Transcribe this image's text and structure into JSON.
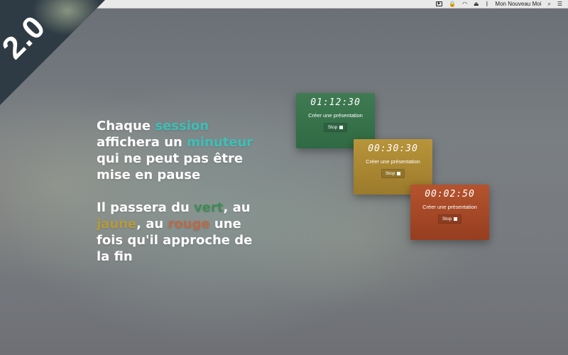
{
  "menubar": {
    "icons": [
      "screen-share-icon",
      "lock-icon",
      "wifi-icon",
      "eject-icon",
      "bluetooth-icon",
      "search-icon",
      "list-icon"
    ],
    "screen_icon_glyph": "▶",
    "lock_glyph": "🔒",
    "wifi_glyph": "◠",
    "eject_glyph": "⏏",
    "bluetooth_glyph": "ᛒ",
    "user_name": "Mon Nouveau Moi",
    "search_glyph": "⌕",
    "list_glyph": "☰"
  },
  "ribbon": {
    "label": "2.0",
    "color": "#2e3b44"
  },
  "copy": {
    "p1_chaque": "Chaque ",
    "p1_session": "session",
    "p1_affichera": " affichera un ",
    "p1_minuteur": "minuteur",
    "p1_rest": " qui ne peut pas être mise en pause",
    "p2_il_passera": "Il passera du ",
    "p2_vert": "vert",
    "p2_au1": ", au ",
    "p2_jaune": "jaune",
    "p2_au2": ", au ",
    "p2_rouge": "rouge",
    "p2_rest": " une fois qu'il approche de la fin"
  },
  "colors": {
    "teal": "#3dbfb8",
    "green": "#3f8a55",
    "yellow": "#b59a3e",
    "red": "#b86a48"
  },
  "timers": [
    {
      "time": "01:12:30",
      "action": "Créer une présentation",
      "stop_label": "Stop",
      "color": "#3f7a52"
    },
    {
      "time": "00:30:30",
      "action": "Créer une présentation",
      "stop_label": "Stop",
      "color": "#b8953a"
    },
    {
      "time": "00:02:50",
      "action": "Créer une présentation",
      "stop_label": "Stop",
      "color": "#b5532e"
    }
  ]
}
